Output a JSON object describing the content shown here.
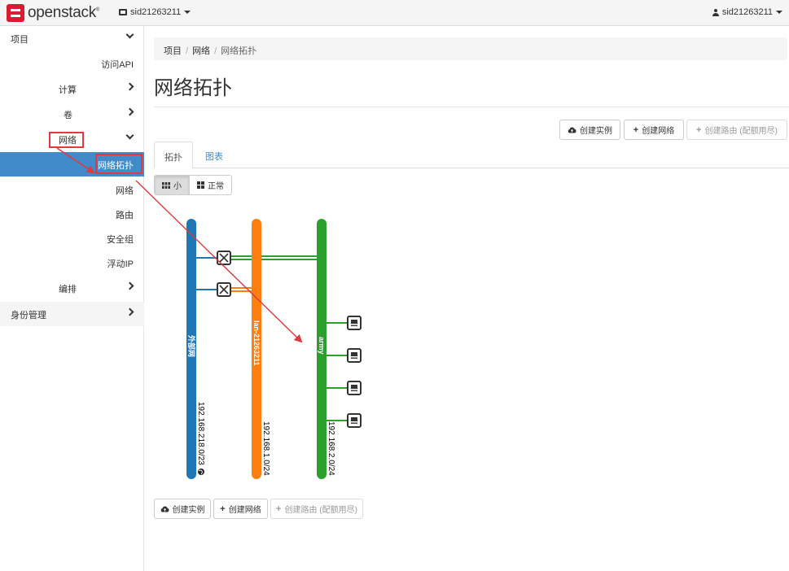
{
  "header": {
    "logo_text": "openstack",
    "logo_mark": "®",
    "project": "sid21263211",
    "user": "sid21263211"
  },
  "sidebar": {
    "project": "项目",
    "access_api": "访问API",
    "compute": "计算",
    "volumes": "卷",
    "network": "网络",
    "topology": "网络拓扑",
    "networks": "网络",
    "routers": "路由",
    "security_groups": "安全组",
    "floating_ips": "浮动IP",
    "orchestration": "编排",
    "identity": "身份管理"
  },
  "breadcrumb": {
    "project": "项目",
    "network": "网络",
    "current": "网络拓扑",
    "sep": "/"
  },
  "page": {
    "title": "网络拓扑"
  },
  "actions": {
    "create_instance": "创建实例",
    "create_network": "创建网络",
    "create_router": "创建路由 (配额用尽)"
  },
  "tabs": {
    "topology": "拓扑",
    "graph": "图表"
  },
  "view_size": {
    "small": "小",
    "normal": "正常"
  },
  "topology": {
    "networks": [
      {
        "name": "外部网",
        "cidr": "192.168.218.0/23",
        "color": "#1f77b4",
        "external": true
      },
      {
        "name": "lan-21263211",
        "cidr": "192.168.1.0/24",
        "color": "#ff7f0e",
        "external": false
      },
      {
        "name": "army",
        "cidr": "192.168.2.0/24",
        "color": "#2ca02c",
        "external": false
      }
    ],
    "routers": 2,
    "instances": 4
  },
  "colors": {
    "accent": "#428bca",
    "annotation_red": "#e0393e"
  },
  "icons": {
    "logo": "openstack-logo-icon",
    "project": "box-icon",
    "user": "user-icon",
    "cloud_upload": "cloud-upload-icon",
    "plus": "plus-icon",
    "grid_small": "th-icon",
    "grid_large": "th-large-icon",
    "router": "router-icon",
    "instance": "server-icon",
    "globe": "globe-icon"
  }
}
